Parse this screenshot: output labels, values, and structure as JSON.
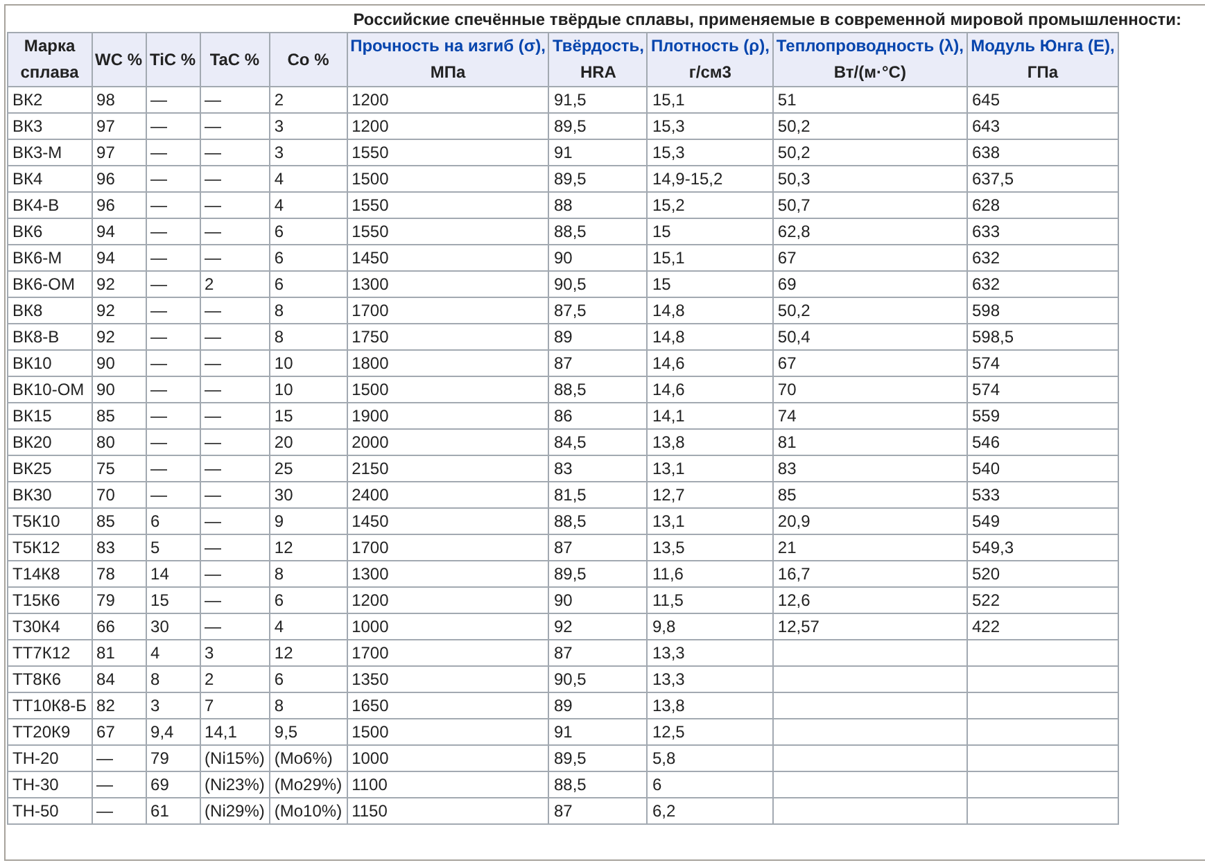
{
  "caption": "Российские спечённые твёрдые сплавы, применяемые в современной мировой промышленности:",
  "columns": [
    {
      "label": "Марка сплава",
      "linked": false
    },
    {
      "label": "WC %",
      "linked": false
    },
    {
      "label": "TiC %",
      "linked": false
    },
    {
      "label": "TaC %",
      "linked": false
    },
    {
      "label": "Co %",
      "linked": false
    },
    {
      "label": "Прочность на изгиб (σ),",
      "unit": "МПа",
      "linked": true
    },
    {
      "label": "Твёрдость,",
      "unit": "HRA",
      "linked": true
    },
    {
      "label": "Плотность (ρ),",
      "unit": "г/см3",
      "linked": true
    },
    {
      "label": "Теплопроводность (λ),",
      "unit": "Вт/(м·°C)",
      "linked": true
    },
    {
      "label": "Модуль Юнга (E),",
      "unit": "ГПа",
      "linked": true
    }
  ],
  "rows": [
    [
      "ВК2",
      "98",
      "—",
      "—",
      "2",
      "1200",
      "91,5",
      "15,1",
      "51",
      "645"
    ],
    [
      "ВК3",
      "97",
      "—",
      "—",
      "3",
      "1200",
      "89,5",
      "15,3",
      "50,2",
      "643"
    ],
    [
      "ВК3-М",
      "97",
      "—",
      "—",
      "3",
      "1550",
      "91",
      "15,3",
      "50,2",
      "638"
    ],
    [
      "ВК4",
      "96",
      "—",
      "—",
      "4",
      "1500",
      "89,5",
      "14,9-15,2",
      "50,3",
      "637,5"
    ],
    [
      "ВК4-В",
      "96",
      "—",
      "—",
      "4",
      "1550",
      "88",
      "15,2",
      "50,7",
      "628"
    ],
    [
      "ВК6",
      "94",
      "—",
      "—",
      "6",
      "1550",
      "88,5",
      "15",
      "62,8",
      "633"
    ],
    [
      "ВК6-М",
      "94",
      "—",
      "—",
      "6",
      "1450",
      "90",
      "15,1",
      "67",
      "632"
    ],
    [
      "ВК6-ОМ",
      "92",
      "—",
      "2",
      "6",
      "1300",
      "90,5",
      "15",
      "69",
      "632"
    ],
    [
      "ВК8",
      "92",
      "—",
      "—",
      "8",
      "1700",
      "87,5",
      "14,8",
      "50,2",
      "598"
    ],
    [
      "ВК8-В",
      "92",
      "—",
      "—",
      "8",
      "1750",
      "89",
      "14,8",
      "50,4",
      "598,5"
    ],
    [
      "ВК10",
      "90",
      "—",
      "—",
      "10",
      "1800",
      "87",
      "14,6",
      "67",
      "574"
    ],
    [
      "ВК10-ОМ",
      "90",
      "—",
      "—",
      "10",
      "1500",
      "88,5",
      "14,6",
      "70",
      "574"
    ],
    [
      "ВК15",
      "85",
      "—",
      "—",
      "15",
      "1900",
      "86",
      "14,1",
      "74",
      "559"
    ],
    [
      "ВК20",
      "80",
      "—",
      "—",
      "20",
      "2000",
      "84,5",
      "13,8",
      "81",
      "546"
    ],
    [
      "ВК25",
      "75",
      "—",
      "—",
      "25",
      "2150",
      "83",
      "13,1",
      "83",
      "540"
    ],
    [
      "ВК30",
      "70",
      "—",
      "—",
      "30",
      "2400",
      "81,5",
      "12,7",
      "85",
      "533"
    ],
    [
      "Т5К10",
      "85",
      "6",
      "—",
      "9",
      "1450",
      "88,5",
      "13,1",
      "20,9",
      "549"
    ],
    [
      "Т5К12",
      "83",
      "5",
      "—",
      "12",
      "1700",
      "87",
      "13,5",
      "21",
      "549,3"
    ],
    [
      "Т14К8",
      "78",
      "14",
      "—",
      "8",
      "1300",
      "89,5",
      "11,6",
      "16,7",
      "520"
    ],
    [
      "Т15К6",
      "79",
      "15",
      "—",
      "6",
      "1200",
      "90",
      "11,5",
      "12,6",
      "522"
    ],
    [
      "Т30К4",
      "66",
      "30",
      "—",
      "4",
      "1000",
      "92",
      "9,8",
      "12,57",
      "422"
    ],
    [
      "ТТ7К12",
      "81",
      "4",
      "3",
      "12",
      "1700",
      "87",
      "13,3"
    ],
    [
      "ТТ8К6",
      "84",
      "8",
      "2",
      "6",
      "1350",
      "90,5",
      "13,3"
    ],
    [
      "ТТ10К8-Б",
      "82",
      "3",
      "7",
      "8",
      "1650",
      "89",
      "13,8"
    ],
    [
      "ТТ20К9",
      "67",
      "9,4",
      "14,1",
      "9,5",
      "1500",
      "91",
      "12,5"
    ],
    [
      "ТН-20",
      "—",
      "79",
      "(Ni15%)",
      "(Mo6%)",
      "1000",
      "89,5",
      "5,8"
    ],
    [
      "ТН-30",
      "—",
      "69",
      "(Ni23%)",
      "(Mo29%)",
      "1100",
      "88,5",
      "6"
    ],
    [
      "ТН-50",
      "—",
      "61",
      "(Ni29%)",
      "(Mo10%)",
      "1150",
      "87",
      "6,2"
    ]
  ]
}
